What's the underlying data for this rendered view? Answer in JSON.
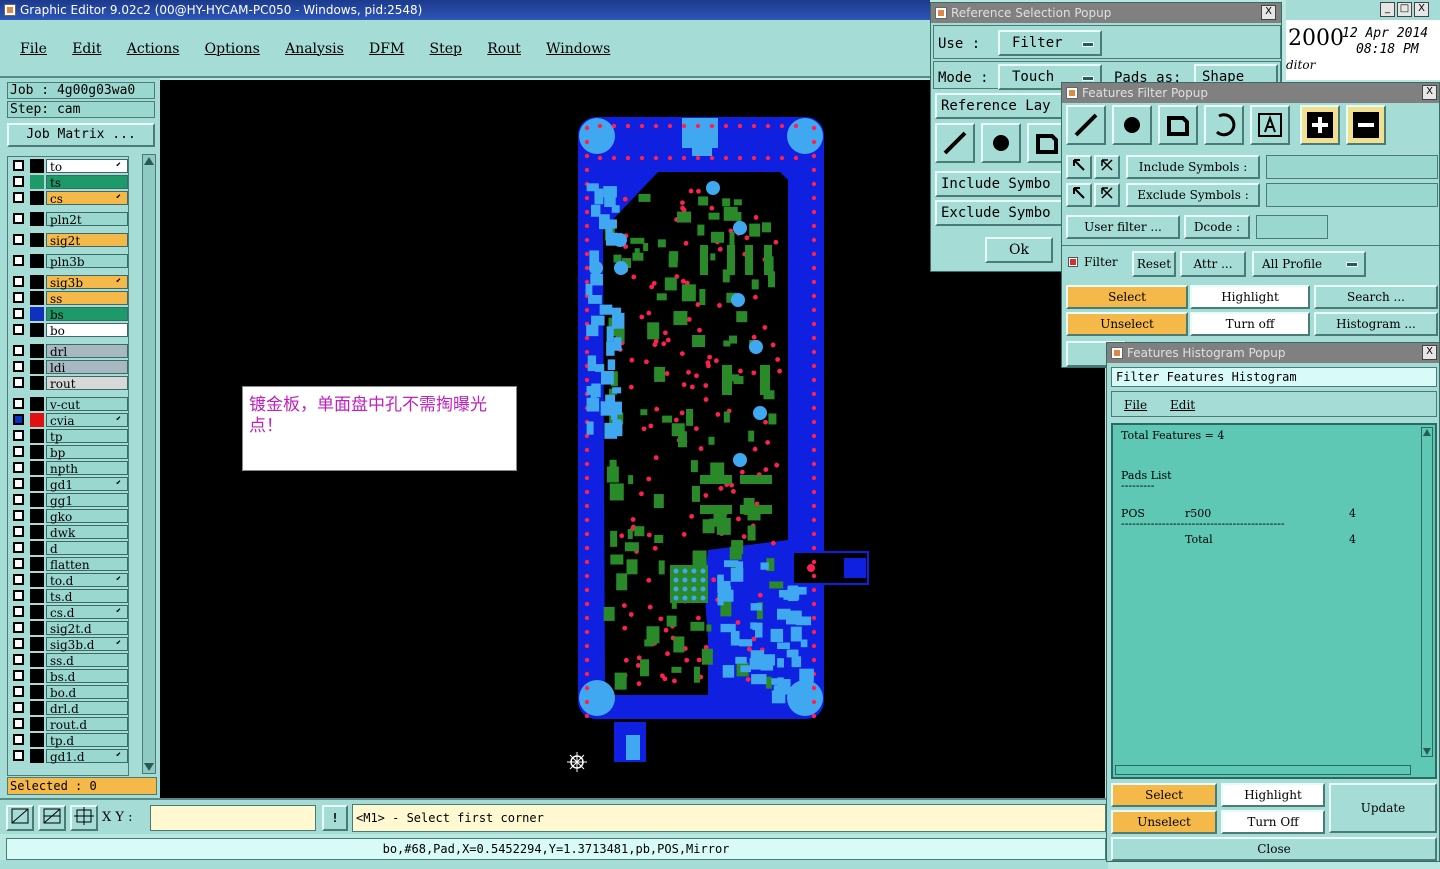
{
  "main_window": {
    "title": "Graphic Editor 9.02c2 (00@HY-HYCAM-PC050 - Windows, pid:2548)",
    "menu": [
      "File",
      "Edit",
      "Actions",
      "Options",
      "Analysis",
      "DFM",
      "Step",
      "Rout",
      "Windows"
    ]
  },
  "job": {
    "job_label": "Job : 4g00g03wa0",
    "step_label": "Step: cam",
    "matrix_button": "Job Matrix ..."
  },
  "layers": [
    {
      "name": "to",
      "color": "#ffffff",
      "swatch": "#000000",
      "arrow": true
    },
    {
      "name": "ts",
      "color": "#1e9a6a",
      "swatch": "#1e9a6a",
      "arrow": false
    },
    {
      "name": "cs",
      "color": "#f5b94a",
      "swatch": "#000000",
      "arrow": true
    },
    {
      "name": "pln2t",
      "color": "#9ad8cf",
      "swatch": "#000000",
      "arrow": false
    },
    {
      "name": "sig2t",
      "color": "#f5b94a",
      "swatch": "#000000",
      "arrow": false
    },
    {
      "name": "pln3b",
      "color": "#9ad8cf",
      "swatch": "#000000",
      "arrow": false
    },
    {
      "name": "sig3b",
      "color": "#f5b94a",
      "swatch": "#000000",
      "arrow": true
    },
    {
      "name": "ss",
      "color": "#f5b94a",
      "swatch": "#000000",
      "arrow": false
    },
    {
      "name": "bs",
      "color": "#1e9a6a",
      "swatch": "#1030c0",
      "arrow": false
    },
    {
      "name": "bo",
      "color": "#ffffff",
      "swatch": "#000000",
      "arrow": false
    },
    {
      "name": "drl",
      "color": "#a8b8c0",
      "swatch": "#000000",
      "arrow": false
    },
    {
      "name": "ldi",
      "color": "#a8b8c0",
      "swatch": "#000000",
      "arrow": false
    },
    {
      "name": "rout",
      "color": "#d8d8d8",
      "swatch": "#000000",
      "arrow": false
    },
    {
      "name": "v-cut",
      "color": "#9ad8cf",
      "swatch": "#000000",
      "arrow": false
    },
    {
      "name": "cvia",
      "color": "#9ad8cf",
      "swatch": "#e01010",
      "arrow": true
    },
    {
      "name": "tp",
      "color": "#9ad8cf",
      "swatch": "#000000",
      "arrow": false
    },
    {
      "name": "bp",
      "color": "#9ad8cf",
      "swatch": "#000000",
      "arrow": false
    },
    {
      "name": "npth",
      "color": "#9ad8cf",
      "swatch": "#000000",
      "arrow": false
    },
    {
      "name": "gd1",
      "color": "#9ad8cf",
      "swatch": "#000000",
      "arrow": true
    },
    {
      "name": "gg1",
      "color": "#9ad8cf",
      "swatch": "#000000",
      "arrow": false
    },
    {
      "name": "gko",
      "color": "#9ad8cf",
      "swatch": "#000000",
      "arrow": false
    },
    {
      "name": "dwk",
      "color": "#9ad8cf",
      "swatch": "#000000",
      "arrow": false
    },
    {
      "name": "d",
      "color": "#9ad8cf",
      "swatch": "#000000",
      "arrow": false
    },
    {
      "name": "flatten",
      "color": "#9ad8cf",
      "swatch": "#000000",
      "arrow": false
    },
    {
      "name": "to.d",
      "color": "#9ad8cf",
      "swatch": "#000000",
      "arrow": true
    },
    {
      "name": "ts.d",
      "color": "#9ad8cf",
      "swatch": "#000000",
      "arrow": false
    },
    {
      "name": "cs.d",
      "color": "#9ad8cf",
      "swatch": "#000000",
      "arrow": true
    },
    {
      "name": "sig2t.d",
      "color": "#9ad8cf",
      "swatch": "#000000",
      "arrow": false
    },
    {
      "name": "sig3b.d",
      "color": "#9ad8cf",
      "swatch": "#000000",
      "arrow": true
    },
    {
      "name": "ss.d",
      "color": "#9ad8cf",
      "swatch": "#000000",
      "arrow": false
    },
    {
      "name": "bs.d",
      "color": "#9ad8cf",
      "swatch": "#000000",
      "arrow": false
    },
    {
      "name": "bo.d",
      "color": "#9ad8cf",
      "swatch": "#000000",
      "arrow": false
    },
    {
      "name": "drl.d",
      "color": "#9ad8cf",
      "swatch": "#000000",
      "arrow": false
    },
    {
      "name": "rout.d",
      "color": "#9ad8cf",
      "swatch": "#000000",
      "arrow": false
    },
    {
      "name": "tp.d",
      "color": "#9ad8cf",
      "swatch": "#000000",
      "arrow": false
    },
    {
      "name": "gd1.d",
      "color": "#9ad8cf",
      "swatch": "#000000",
      "arrow": true
    }
  ],
  "selected_label": "Selected : 0",
  "note": "镀金板，单面盘中孔不需掏曝光点！",
  "bottom": {
    "xy_label": "X Y :",
    "xy_value": "",
    "prompt": "<M1> - Select first corner",
    "status": "bo,#68,Pad,X=0.5452294,Y=1.3713481,pb,POS,Mirror"
  },
  "clock": {
    "year": "2000",
    "date": "12 Apr 2014",
    "time": "08:18 PM",
    "editor": "ditor"
  },
  "ref_popup": {
    "title": "Reference Selection Popup",
    "use_label": "Use :",
    "use_value": "Filter",
    "mode_label": "Mode :",
    "mode_value": "Touch",
    "pads_label": "Pads as:",
    "pads_value": "Shape",
    "ref_layer": "Reference Lay",
    "include_symbols": "Include Symbo",
    "exclude_symbols": "Exclude Symbo",
    "ok": "Ok"
  },
  "filter_popup": {
    "title": "Features Filter Popup",
    "include_symbols": "Include Symbols :",
    "exclude_symbols": "Exclude Symbols :",
    "include_value": "",
    "exclude_value": "",
    "user_filter": "User filter ...",
    "dcode": "Dcode :",
    "dcode_value": "",
    "filter": "Filter",
    "reset": "Reset",
    "attr": "Attr ...",
    "profile": "All Profile",
    "select": "Select",
    "highlight": "Highlight",
    "search": "Search ...",
    "unselect": "Unselect",
    "turn_off": "Turn off",
    "histogram": "Histogram ..."
  },
  "histogram_popup": {
    "title": "Features Histogram Popup",
    "header": "Filter Features Histogram",
    "menu": [
      "File",
      "Edit"
    ],
    "total_features": "Total Features = 4",
    "pads_list": "Pads List",
    "pads_underline": "---------",
    "row_pol": "POS",
    "row_sym": "r500",
    "row_count": "4",
    "rule": "--------------------------------------------",
    "total_label": "Total",
    "total_value": "4",
    "select": "Select",
    "highlight": "Highlight",
    "update": "Update",
    "unselect": "Unselect",
    "turn_off": "Turn Off",
    "close": "Close"
  },
  "colors": {
    "board_blue": "#1020e0",
    "pad_light": "#40a8f0",
    "pad_green": "#2a8a2a",
    "via_red": "#ff2050",
    "panel": "#a6dcd6",
    "accent_orange": "#f5b94a"
  }
}
